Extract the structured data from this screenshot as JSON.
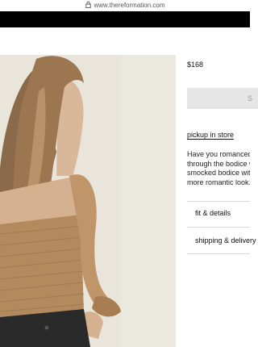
{
  "browser": {
    "url": "www.thereformation.com",
    "lock_icon": "lock-icon"
  },
  "product": {
    "price": "$168",
    "cta_label": "S",
    "pickup_link": "pickup in store",
    "description_lines": [
      "Have you romanced y",
      "through the bodice w",
      "smocked bodice with",
      "more romantic look."
    ],
    "accordion": [
      {
        "label": "fit & details"
      },
      {
        "label": "shipping & delivery"
      }
    ]
  },
  "colors": {
    "header_bar": "#000000",
    "cta_bg": "#e6e6e6",
    "top_fabric": "#b38a5e"
  }
}
